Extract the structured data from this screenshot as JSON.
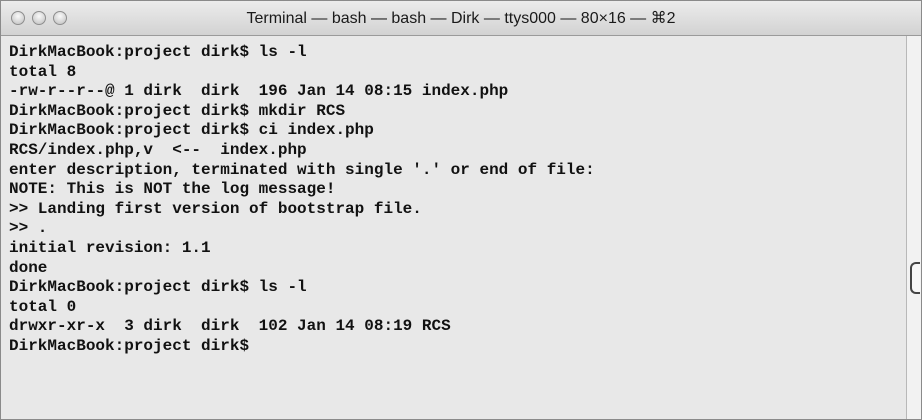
{
  "window": {
    "title": "Terminal — bash — bash — Dirk — ttys000 — 80×16 — ⌘2"
  },
  "terminal": {
    "lines": [
      "DirkMacBook:project dirk$ ls -l",
      "total 8",
      "-rw-r--r--@ 1 dirk  dirk  196 Jan 14 08:15 index.php",
      "DirkMacBook:project dirk$ mkdir RCS",
      "DirkMacBook:project dirk$ ci index.php",
      "RCS/index.php,v  <--  index.php",
      "enter description, terminated with single '.' or end of file:",
      "NOTE: This is NOT the log message!",
      ">> Landing first version of bootstrap file.",
      ">> .",
      "initial revision: 1.1",
      "done",
      "DirkMacBook:project dirk$ ls -l",
      "total 0",
      "drwxr-xr-x  3 dirk  dirk  102 Jan 14 08:19 RCS",
      "DirkMacBook:project dirk$ "
    ]
  },
  "icons": {
    "close": "close-button-icon",
    "minimize": "minimize-button-icon",
    "zoom": "zoom-button-icon"
  }
}
